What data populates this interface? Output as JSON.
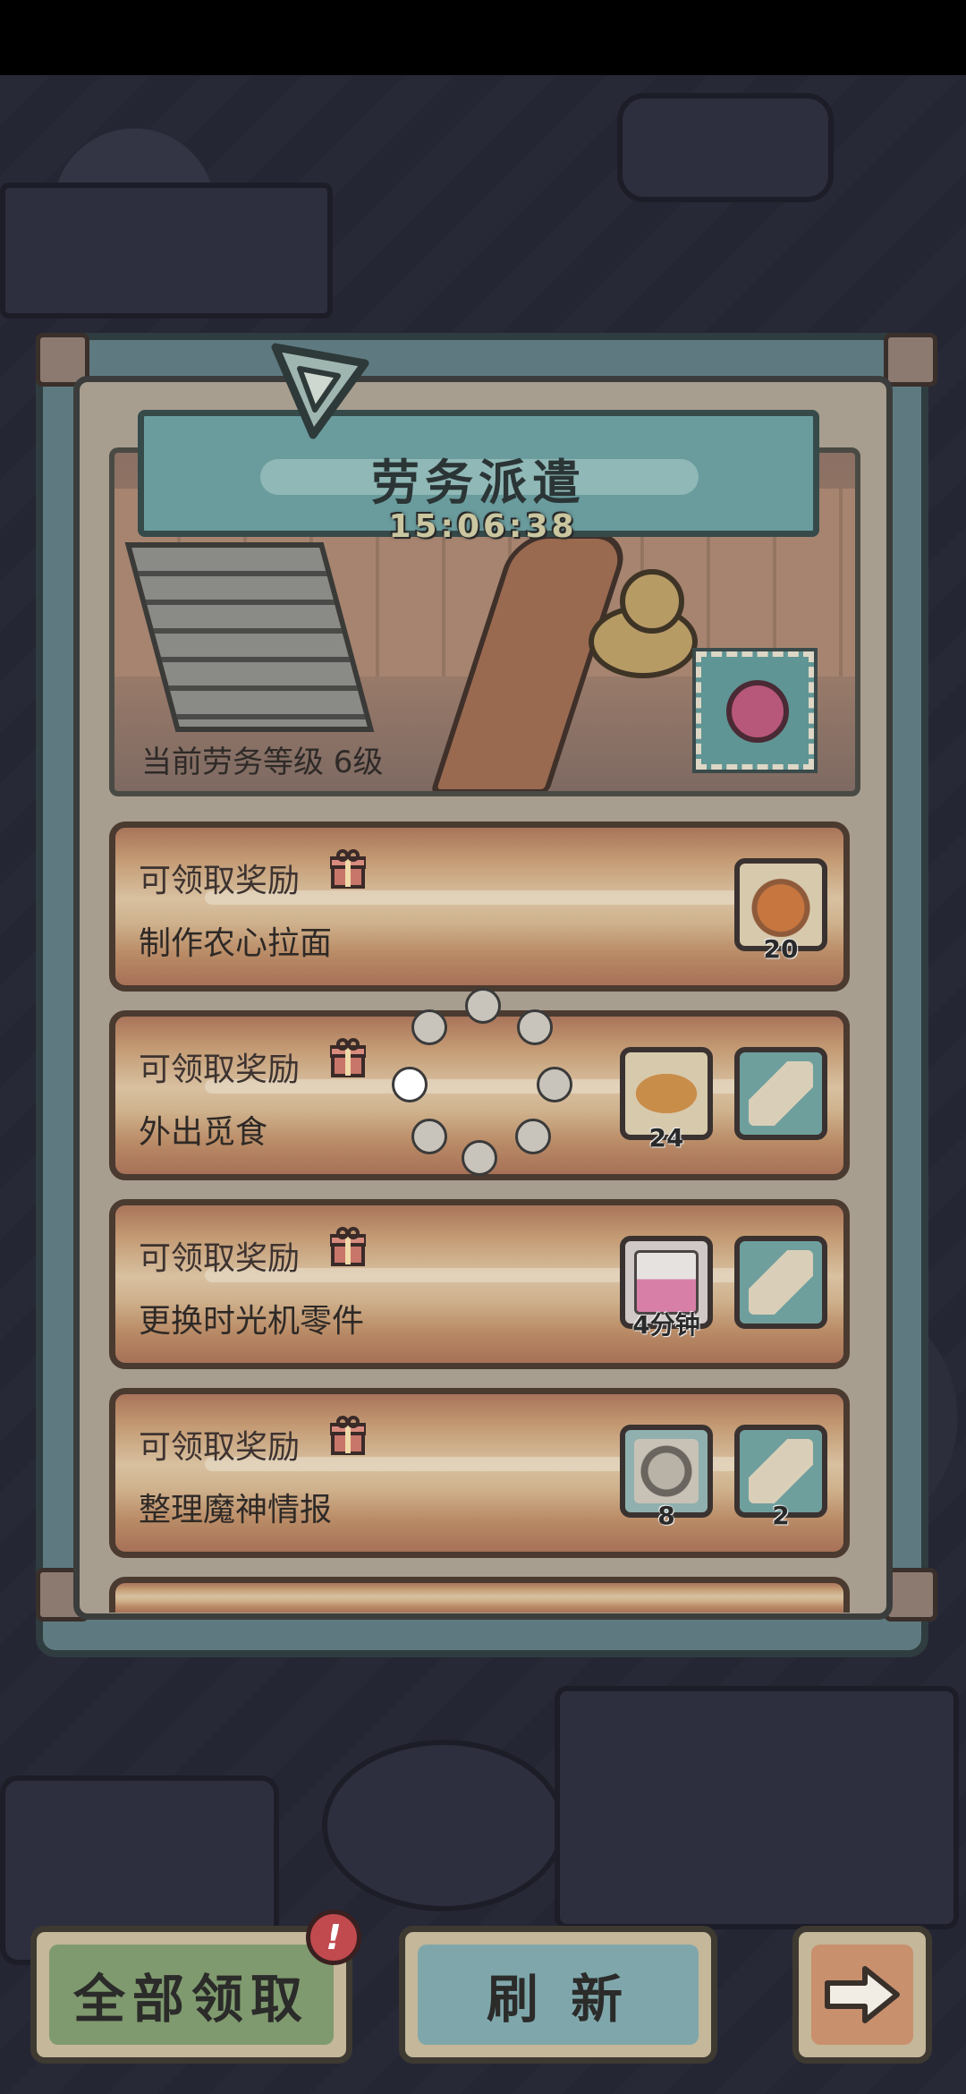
{
  "panel": {
    "title": "劳务派遣",
    "timer": "15:06:38",
    "level_text": "当前劳务等级  6级"
  },
  "tasks": [
    {
      "status": "可领取奖励",
      "name": "制作农心拉面",
      "rewards": [
        {
          "item": "ramen-bowl",
          "qty": "20"
        }
      ]
    },
    {
      "status": "可领取奖励",
      "name": "外出觅食",
      "rewards": [
        {
          "item": "taiyaki-fish",
          "qty": "24"
        },
        {
          "item": "scroll",
          "qty": ""
        }
      ]
    },
    {
      "status": "可领取奖励",
      "name": "更换时光机零件",
      "rewards": [
        {
          "item": "potion-jug",
          "qty": "4分钟"
        },
        {
          "item": "scroll",
          "qty": ""
        }
      ]
    },
    {
      "status": "可领取奖励",
      "name": "整理魔神情报",
      "rewards": [
        {
          "item": "machine-part",
          "qty": "8"
        },
        {
          "item": "scroll",
          "qty": "2"
        }
      ]
    }
  ],
  "buttons": {
    "claim_all": "全部领取",
    "refresh": "刷 新",
    "badge": "!"
  },
  "icons": {
    "gift": "gift-icon",
    "next": "arrow-right-icon",
    "loading": "loading-spinner"
  },
  "colors": {
    "teal_plate": "#6a9c9e",
    "claim_button": "#7f9a6e",
    "refresh_button": "#7fa7ab",
    "next_button": "#c9906e",
    "badge": "#c14a4f"
  }
}
